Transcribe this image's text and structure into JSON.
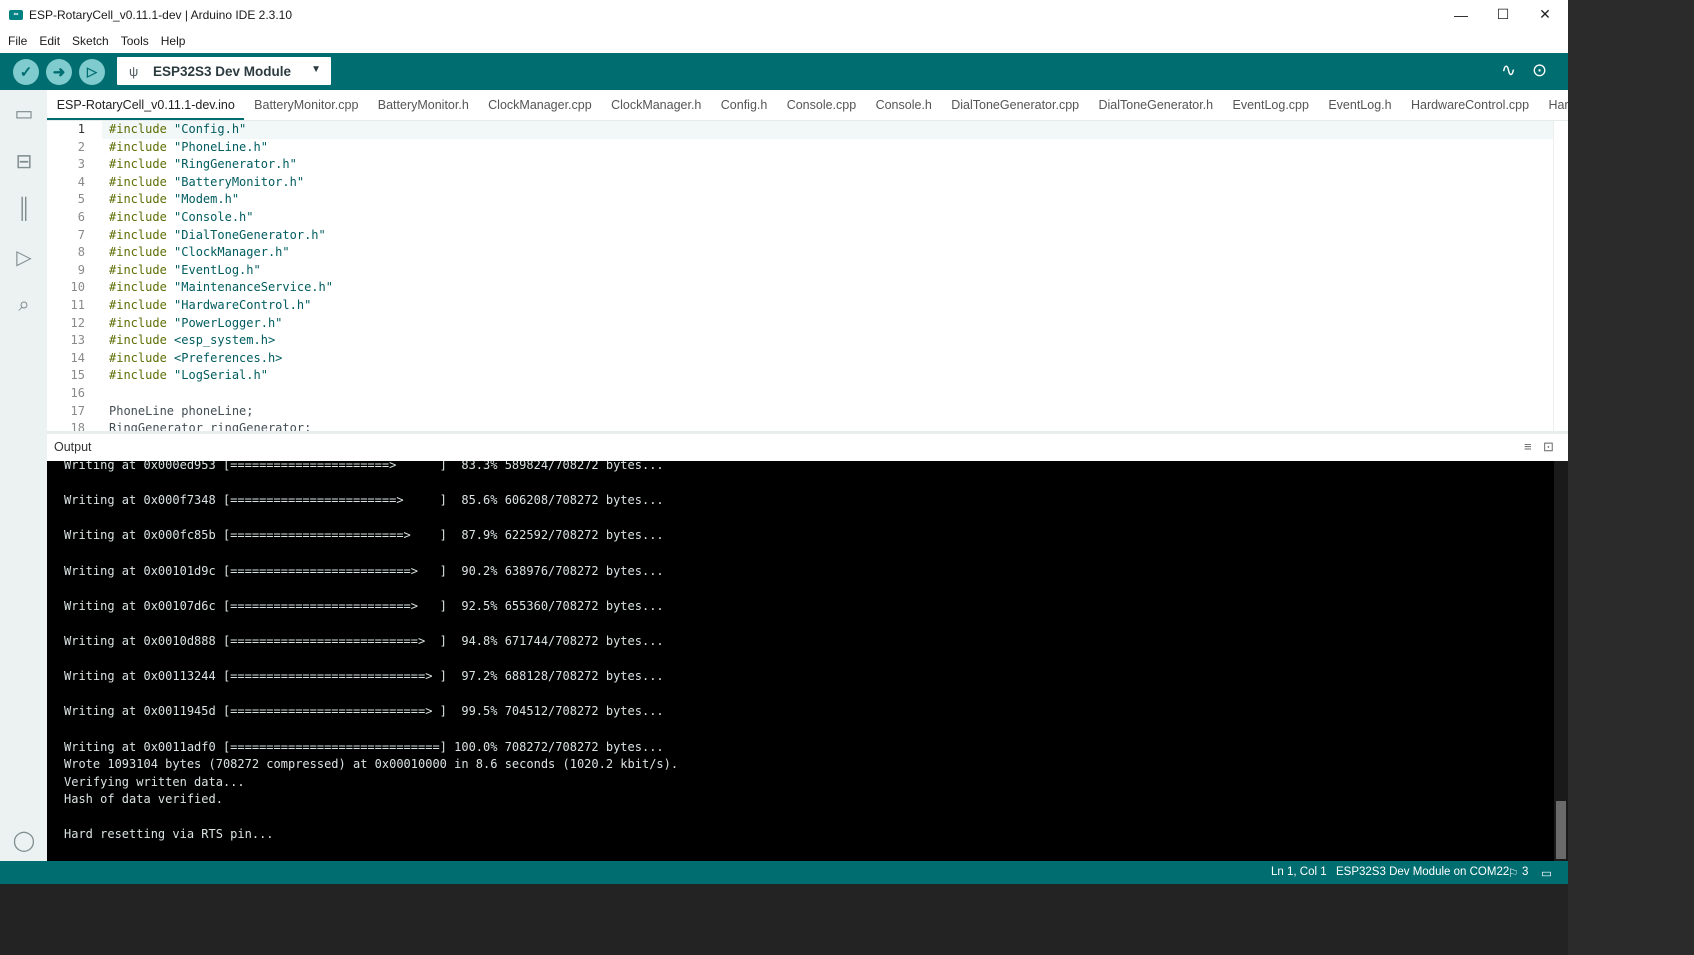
{
  "window": {
    "title": "ESP-RotaryCell_v0.11.1-dev | Arduino IDE 2.3.10",
    "app_icon": "arduino-icon",
    "controls": {
      "minimize": "—",
      "maximize": "☐",
      "close": "✕"
    }
  },
  "menu": [
    "File",
    "Edit",
    "Sketch",
    "Tools",
    "Help"
  ],
  "toolbar": {
    "verify_icon": "check-icon",
    "upload_icon": "arrow-right-icon",
    "debug_icon": "debug-icon",
    "board": "ESP32S3 Dev Module",
    "serial_plotter_icon": "plotter-icon",
    "serial_monitor_icon": "monitor-icon"
  },
  "sidebar": [
    "folder-icon",
    "board-icon",
    "library-icon",
    "debug-icon",
    "search-icon",
    "account-icon"
  ],
  "tabs": [
    "ESP-RotaryCell_v0.11.1-dev.ino",
    "BatteryMonitor.cpp",
    "BatteryMonitor.h",
    "ClockManager.cpp",
    "ClockManager.h",
    "Config.h",
    "Console.cpp",
    "Console.h",
    "DialToneGenerator.cpp",
    "DialToneGenerator.h",
    "EventLog.cpp",
    "EventLog.h",
    "HardwareControl.cpp",
    "HardwareC•••"
  ],
  "editor": {
    "lines": [
      {
        "n": "1",
        "kw": "#include",
        "arg": " \"Config.h\""
      },
      {
        "n": "2",
        "kw": "#include",
        "arg": " \"PhoneLine.h\""
      },
      {
        "n": "3",
        "kw": "#include",
        "arg": " \"RingGenerator.h\""
      },
      {
        "n": "4",
        "kw": "#include",
        "arg": " \"BatteryMonitor.h\""
      },
      {
        "n": "5",
        "kw": "#include",
        "arg": " \"Modem.h\""
      },
      {
        "n": "6",
        "kw": "#include",
        "arg": " \"Console.h\""
      },
      {
        "n": "7",
        "kw": "#include",
        "arg": " \"DialToneGenerator.h\""
      },
      {
        "n": "8",
        "kw": "#include",
        "arg": " \"ClockManager.h\""
      },
      {
        "n": "9",
        "kw": "#include",
        "arg": " \"EventLog.h\""
      },
      {
        "n": "10",
        "kw": "#include",
        "arg": " \"MaintenanceService.h\""
      },
      {
        "n": "11",
        "kw": "#include",
        "arg": " \"HardwareControl.h\""
      },
      {
        "n": "12",
        "kw": "#include",
        "arg": " \"PowerLogger.h\""
      },
      {
        "n": "13",
        "kw": "#include",
        "arg": " <esp_system.h>"
      },
      {
        "n": "14",
        "kw": "#include",
        "arg": " <Preferences.h>"
      },
      {
        "n": "15",
        "kw": "#include",
        "arg": " \"LogSerial.h\""
      },
      {
        "n": "16",
        "kw": "",
        "arg": ""
      },
      {
        "n": "17",
        "kw": "",
        "arg": "PhoneLine phoneLine;"
      },
      {
        "n": "18",
        "kw": "",
        "arg": "RingGenerator ringGenerator;"
      }
    ]
  },
  "output": {
    "title": "Output",
    "clear_icon": "clear-list-icon",
    "lock_icon": "lock-icon",
    "lines": [
      "Writing at 0x000ed953 [======================>      ]  83.3% 589824/708272 bytes...",
      "",
      "Writing at 0x000f7348 [=======================>     ]  85.6% 606208/708272 bytes...",
      "",
      "Writing at 0x000fc85b [========================>    ]  87.9% 622592/708272 bytes...",
      "",
      "Writing at 0x00101d9c [=========================>   ]  90.2% 638976/708272 bytes...",
      "",
      "Writing at 0x00107d6c [=========================>   ]  92.5% 655360/708272 bytes...",
      "",
      "Writing at 0x0010d888 [==========================>  ]  94.8% 671744/708272 bytes...",
      "",
      "Writing at 0x00113244 [===========================> ]  97.2% 688128/708272 bytes...",
      "",
      "Writing at 0x0011945d [===========================> ]  99.5% 704512/708272 bytes...",
      "",
      "Writing at 0x0011adf0 [=============================] 100.0% 708272/708272 bytes...",
      "Wrote 1093104 bytes (708272 compressed) at 0x00010000 in 8.6 seconds (1020.2 kbit/s).",
      "Verifying written data...",
      "Hash of data verified.",
      "",
      "Hard resetting via RTS pin..."
    ]
  },
  "status": {
    "position": "Ln 1, Col 1",
    "board_port": "ESP32S3 Dev Module on COM22",
    "notifications": "3",
    "notif_icon": "bell-icon",
    "panel_icon": "panel-icon"
  },
  "colors": {
    "accent": "#006d70",
    "keyword": "#5e6d03",
    "string": "#005c5f"
  }
}
